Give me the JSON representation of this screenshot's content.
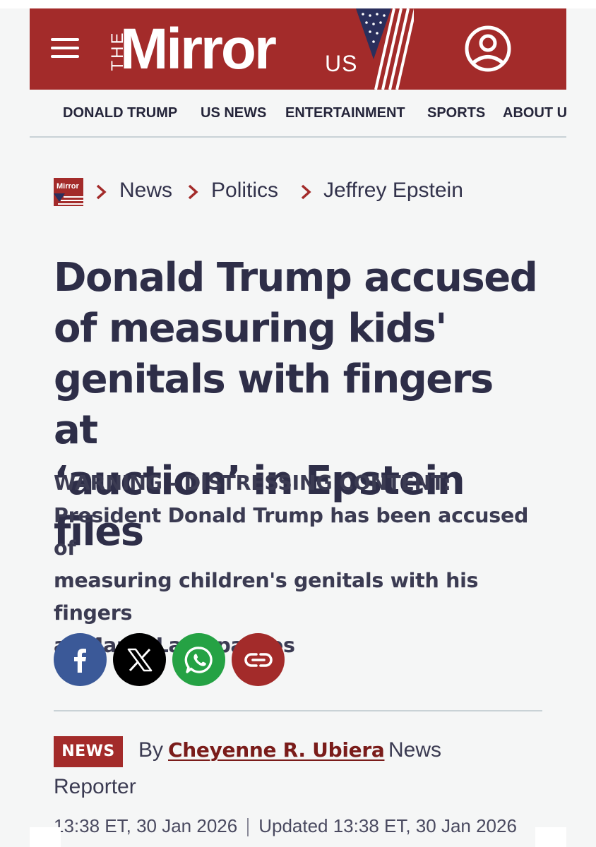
{
  "header": {
    "logo_the": "THE",
    "logo_name": "Mirror",
    "logo_region": "US",
    "brand_color": "#a32b2a",
    "menu_icon": "hamburger-menu-icon",
    "account_icon": "user-account-icon"
  },
  "nav": {
    "items": [
      "DONALD TRUMP",
      "US NEWS",
      "ENTERTAINMENT",
      "SPORTS",
      "ABOUT U"
    ]
  },
  "breadcrumb": {
    "logo_text": "Mirror",
    "items": [
      "News",
      "Politics",
      "Jeffrey Epstein"
    ]
  },
  "article": {
    "headline_lines": [
      "Donald Trump accused",
      "of measuring kids'",
      "genitals with fingers at",
      "‘auction’ in Epstein files"
    ],
    "standfirst_lines": [
      "WARNING - DISTRESSING CONTENT:",
      "President Donald Trump has been accused of",
      "measuring children's genitals with his fingers",
      "at Mar-a-Lago parties"
    ],
    "share": {
      "facebook_color": "#3b5998",
      "x_color": "#000000",
      "whatsapp_color": "#25a244",
      "link_color": "#a32b2a"
    },
    "byline": {
      "badge": "NEWS",
      "by": "By",
      "author": "Cheyenne R. Ubiera",
      "role_part1": "News",
      "role_part2": "Reporter"
    },
    "dates": {
      "published": "13:38 ET, 30 Jan 2026",
      "updated": "Updated 13:38 ET, 30 Jan 2026"
    }
  }
}
